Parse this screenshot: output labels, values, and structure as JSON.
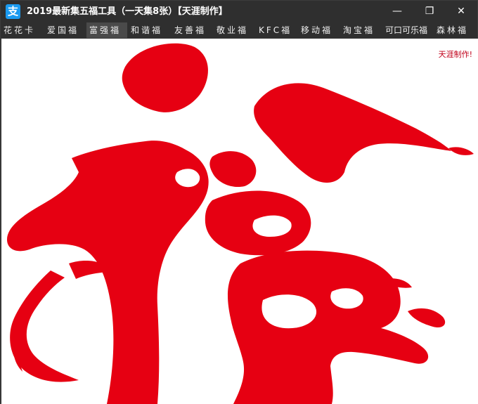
{
  "window": {
    "title": "2019最新集五福工具（一天集8张）【天涯制作】",
    "app_icon_glyph": "支",
    "controls": {
      "minimize": "—",
      "maximize": "❐",
      "close": "✕"
    }
  },
  "menu": {
    "items": [
      {
        "label": "花花卡"
      },
      {
        "label": "爱国福"
      },
      {
        "label": "富强福",
        "active": true
      },
      {
        "label": "和谐福"
      },
      {
        "label": "友善福"
      },
      {
        "label": "敬业福"
      },
      {
        "label": "KFC福"
      },
      {
        "label": "移动福"
      },
      {
        "label": "淘宝福"
      },
      {
        "label": "可口可乐福"
      },
      {
        "label": "森林福"
      }
    ]
  },
  "content": {
    "credit": "天涯制作!",
    "image": {
      "description_icon": "fu-calligraphy-icon",
      "color": "#e60012"
    }
  },
  "colors": {
    "accent_red": "#e60012",
    "titlebar_bg": "#2f2f2f",
    "content_bg": "#ffffff"
  }
}
